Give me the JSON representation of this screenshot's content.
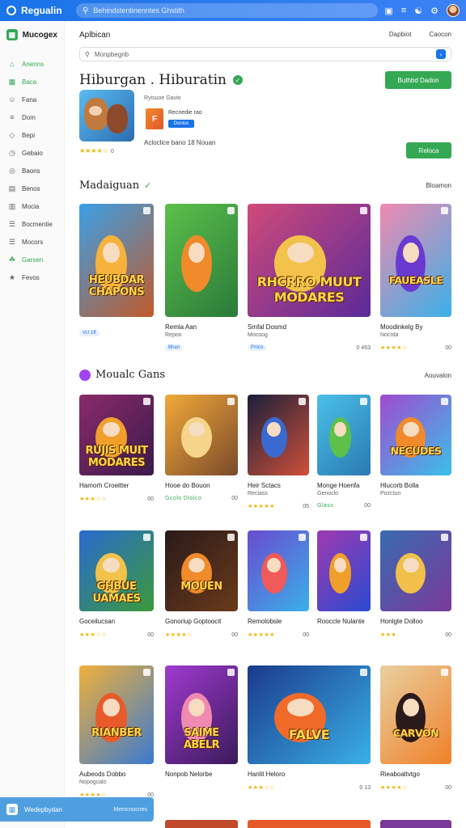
{
  "topbar": {
    "brand": "Regualin",
    "address": "Behindstentinenntes Ghstith",
    "icons": [
      "search-icon",
      "bookmark-icon",
      "menu-icon",
      "help-icon",
      "settings-icon"
    ]
  },
  "sidebar": {
    "title": "Mucogex",
    "items": [
      {
        "label": "Anenns",
        "icon": "home-icon",
        "active": true
      },
      {
        "label": "Baca",
        "icon": "grid-icon",
        "active": true
      },
      {
        "label": "Fana",
        "icon": "people-icon"
      },
      {
        "label": "Dom",
        "icon": "chart-icon"
      },
      {
        "label": "Bepi",
        "icon": "tag-icon"
      },
      {
        "label": "Gebaio",
        "icon": "clock-icon"
      },
      {
        "label": "Baons",
        "icon": "globe-icon"
      },
      {
        "label": "Benos",
        "icon": "doc-icon"
      },
      {
        "label": "Mocia",
        "icon": "book-icon"
      },
      {
        "label": "Bocmentie",
        "icon": "list-icon"
      },
      {
        "label": "Mocors",
        "icon": "list-icon"
      },
      {
        "label": "Garsen",
        "icon": "leaf-icon",
        "active": true
      },
      {
        "label": "Fevos",
        "icon": "gift-icon"
      }
    ]
  },
  "header": {
    "title": "Aplbican",
    "links": [
      "Dapbiot",
      "Caocon"
    ]
  },
  "search": {
    "placeholder": "Monpbegnb"
  },
  "hero": {
    "title": "Hiburgan . Hiburatin",
    "install_label": "Buthbd Dadon",
    "meta": "Ryisuoe Gavio",
    "developer": "Recnedie rao",
    "tag": "Doniso",
    "stars": "★★★★☆",
    "rating": "0",
    "description": "Acloclice bano 18 Nouan",
    "get_label": "Reloca"
  },
  "sections": [
    {
      "title": "Madaiguan",
      "link": "Bloamon"
    },
    {
      "title": "Moualc Gans",
      "link": "Aouvalon"
    }
  ],
  "row1": [
    {
      "title": "HEUBDAR CHAPONS",
      "name": "",
      "sub": "",
      "pill": "VU 1ff",
      "stars": "",
      "num": ""
    },
    {
      "title": "",
      "name": "Remla Aan",
      "sub": "Repoo",
      "pill": "Bhan",
      "stars": "",
      "num": ""
    },
    {
      "title": "RHCRRO MUUT MODARES",
      "name": "Smfal Dosmd",
      "sub": "Mocoog",
      "pill": "Pmco",
      "stars": "★★★★",
      "num": "0 463"
    },
    {
      "title": "FAUEASLE",
      "name": "Moodinkelg By",
      "sub": "Nocrda",
      "pill": "",
      "stars": "★★★★☆",
      "num": "00"
    }
  ],
  "row2": [
    {
      "title": "RUJIS MUIT MODARES",
      "name": "Hamorh Croeitter",
      "sub": "",
      "stars": "★★★☆☆",
      "num": "00"
    },
    {
      "title": "",
      "name": "Hooe do Bouon",
      "sub": "",
      "stars": "Gcols Dlolco",
      "num": "00"
    },
    {
      "title": "",
      "name": "Heir Sctacs",
      "sub": "Reciass",
      "stars": "★★★★★",
      "num": "05"
    },
    {
      "title": "",
      "name": "Monge Hoenfa",
      "sub": "Genoclo",
      "stars": "Glass",
      "num": "00"
    },
    {
      "title": "NECUDES",
      "name": "Hlucorb Bolla",
      "sub": "Pozctun",
      "stars": "",
      "num": ""
    }
  ],
  "row3": [
    {
      "title": "GHBUE UAMAES",
      "name": "Goceilucsan",
      "sub": "",
      "stars": "★★★☆☆",
      "num": "00"
    },
    {
      "title": "MOUEN",
      "name": "Gonoriup Goptoocit",
      "sub": "",
      "stars": "★★★★☆",
      "num": "00"
    },
    {
      "title": "",
      "name": "Remolobsle",
      "sub": "",
      "stars": "★★★★★",
      "num": "00"
    },
    {
      "title": "",
      "name": "Rooccle Nulante",
      "sub": "",
      "stars": "",
      "num": ""
    },
    {
      "title": "",
      "name": "Honlgte Dolloo",
      "sub": "",
      "stars": "★★★",
      "num": "00"
    }
  ],
  "row4": [
    {
      "title": "RIANBER",
      "name": "Aubeods Dobbo",
      "sub": "Nopogcalo",
      "stars": "★★★★☆",
      "num": "00"
    },
    {
      "title": "SAIME ABELR",
      "name": "Nonpob Nelorbe",
      "sub": "",
      "stars": "",
      "num": ""
    },
    {
      "title": "FALVE",
      "name": "Hanlit Heloro",
      "sub": "",
      "stars": "★★★☆☆",
      "num": "0 13"
    },
    {
      "title": "CARVON",
      "name": "Rieaboaltvtgo",
      "sub": "",
      "stars": "★★★★☆",
      "num": "00"
    }
  ],
  "toast": {
    "title": "Wedepbydan",
    "sub": "Memcnocnes"
  },
  "colors": {
    "accent": "#1a73e8",
    "brand_green": "#34a853",
    "star": "#f4b400"
  }
}
